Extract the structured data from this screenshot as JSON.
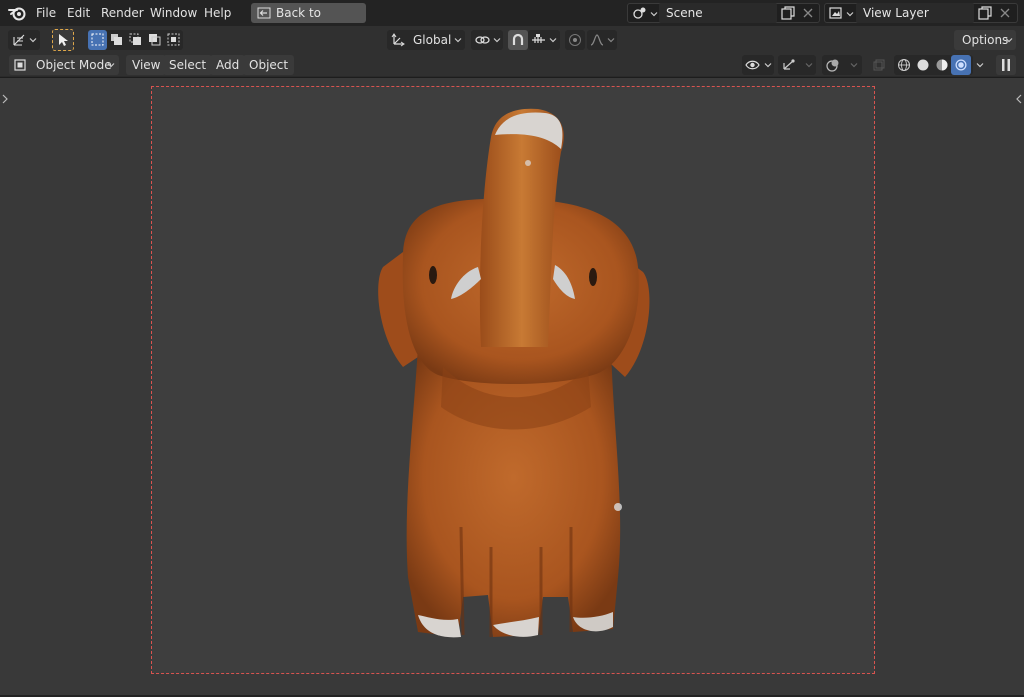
{
  "topbar": {
    "menu": [
      "File",
      "Edit",
      "Render",
      "Window",
      "Help"
    ],
    "back_button": "Back to Previous",
    "scene": {
      "icon": "scene-icon",
      "value": "Scene"
    },
    "view_layer": {
      "icon": "view-layer-icon",
      "value": "View Layer"
    }
  },
  "header1": {
    "transform_orientation": "Global",
    "options_label": "Options"
  },
  "header2": {
    "mode": "Object Mode",
    "menus": [
      "View",
      "Select",
      "Add",
      "Object"
    ]
  },
  "colors": {
    "camera_border": "#d9534f",
    "accent": "#4772b3",
    "active_tool": "#e0a84a",
    "elephant_body": "#b8622a"
  }
}
